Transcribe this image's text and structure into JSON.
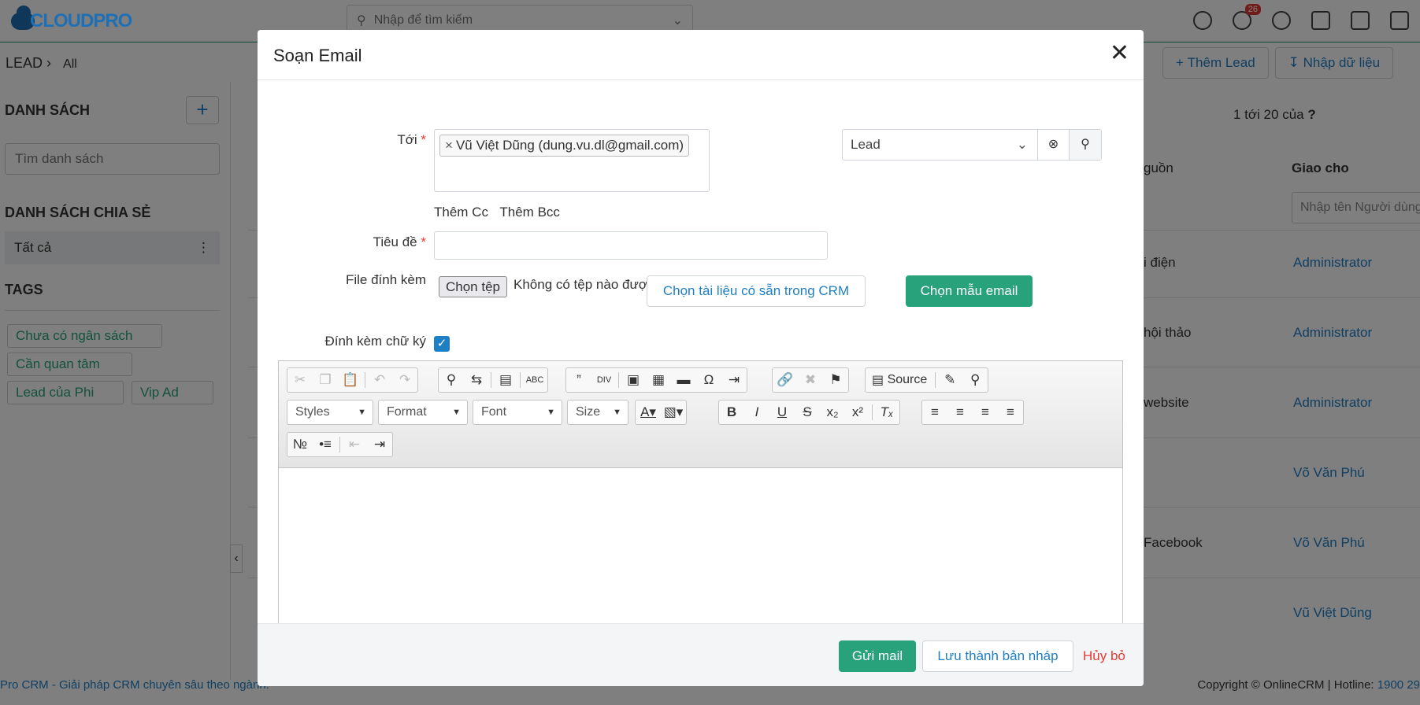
{
  "app": {
    "logo_text": "CLOUDPRO",
    "search_placeholder": "Nhập để tìm kiếm",
    "notification_count": "26",
    "breadcrumb": {
      "module": "LEAD",
      "view": "All"
    },
    "actions": {
      "add_lead": "Thêm Lead",
      "import": "Nhập dữ liệu"
    },
    "pagination": {
      "range": "1 tới 20",
      "of": "của"
    },
    "sidebar": {
      "lists_title": "DANH SÁCH",
      "list_search_placeholder": "Tìm danh sách",
      "shared_title": "DANH SÁCH CHIA SẺ",
      "shared_item": "Tất cả",
      "tags_title": "TAGS",
      "tags": [
        "Chưa có ngân sách",
        "Cần quan tâm",
        "Lead của Phi",
        "Vip Ad"
      ]
    },
    "grid": {
      "col_source": "guồn",
      "col_assigned": "Giao cho",
      "assigned_filter_placeholder": "Nhập tên Người dùng",
      "rows": [
        {
          "source": "i điện",
          "assigned": "Administrator"
        },
        {
          "source": "hội thảo",
          "assigned": "Administrator"
        },
        {
          "source": "website",
          "assigned": "Administrator"
        },
        {
          "source": "",
          "assigned": "Võ Văn Phú"
        },
        {
          "source": "Facebook",
          "assigned": "Võ Văn Phú"
        },
        {
          "source": "",
          "assigned": "Vũ Việt Dũng"
        }
      ]
    },
    "footer": {
      "left": "Pro CRM - Giải pháp CRM chuyên sâu theo ngành.",
      "right_prefix": "Copyright © OnlineCRM | Hotline: ",
      "hotline": "1900 29"
    }
  },
  "modal": {
    "title": "Soạn Email",
    "to_label": "Tới",
    "recipient_name": "Vũ Việt Dũng",
    "recipient_email": "(dung.vu.dl@gmail.com)",
    "add_cc": "Thêm Cc",
    "add_bcc": "Thêm Bcc",
    "module_select": "Lead",
    "subject_label": "Tiêu đề",
    "subject_value": "",
    "attachment_label": "File đính kèm",
    "choose_file": "Chọn tệp",
    "no_file": "Không có tệp nào được chọn",
    "crm_docs_button": "Chọn tài liệu có sẵn trong CRM",
    "template_button": "Chọn mẫu email",
    "signature_label": "Đính kèm chữ ký",
    "signature_checked": true,
    "editor": {
      "source_label": "Source",
      "styles": "Styles",
      "format": "Format",
      "font": "Font",
      "size": "Size"
    },
    "send_button": "Gửi mail",
    "draft_button": "Lưu thành bản nháp",
    "cancel_button": "Hủy bỏ"
  },
  "colors": {
    "primary_green": "#27a27b",
    "link_blue": "#1f7fc4",
    "danger_red": "#e53935"
  }
}
